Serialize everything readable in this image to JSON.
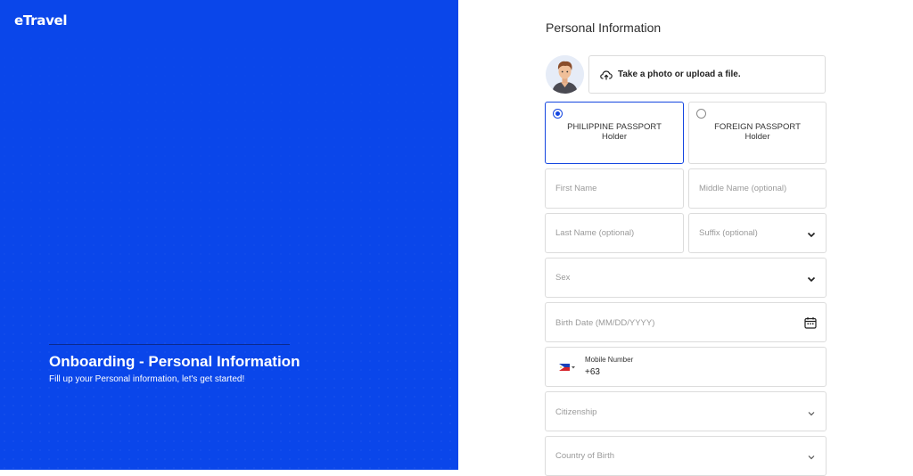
{
  "brand": {
    "logo_text": "eTravel"
  },
  "hero": {
    "title": "Onboarding - Personal Information",
    "subtitle": "Fill up your Personal information, let's get started!"
  },
  "form": {
    "section_title": "Personal Information",
    "upload_label": "Take a photo or upload a file.",
    "passport_options": [
      {
        "label_line1": "PHILIPPINE PASSPORT",
        "label_line2": "Holder",
        "selected": true
      },
      {
        "label_line1": "FOREIGN PASSPORT",
        "label_line2": "Holder",
        "selected": false
      }
    ],
    "first_name_placeholder": "First Name",
    "middle_name_placeholder": "Middle Name (optional)",
    "last_name_placeholder": "Last Name (optional)",
    "suffix_placeholder": "Suffix (optional)",
    "sex_placeholder": "Sex",
    "birth_date_placeholder": "Birth Date (MM/DD/YYYY)",
    "mobile_label": "Mobile Number",
    "mobile_value": "+63",
    "citizenship_placeholder": "Citizenship",
    "country_of_birth_placeholder": "Country of Birth"
  },
  "icons": {
    "upload": "cloud-upload-icon",
    "chevron": "chevron-down-icon",
    "calendar": "calendar-icon",
    "flag": "philippines-flag-icon"
  },
  "colors": {
    "primary_blue": "#0a46ea",
    "selected_border": "#1446e0",
    "field_border": "#dcdcdc",
    "placeholder": "#9a9a9a"
  }
}
